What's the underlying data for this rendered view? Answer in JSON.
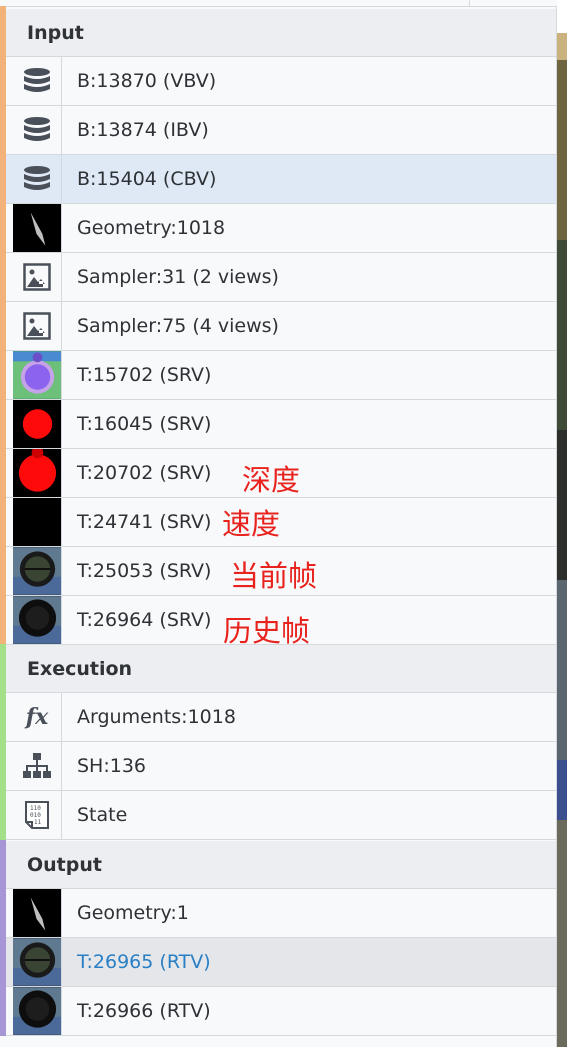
{
  "colors": {
    "input_accent": "#f2b27a",
    "execution_accent": "#a4e08a",
    "output_accent": "#a796d6",
    "link": "#2a7fc4",
    "annotation": "#e8231e",
    "selected_row": "#dfe9f6"
  },
  "sections": {
    "input": {
      "title": "Input",
      "rows": [
        {
          "label": "B:13870 (VBV)",
          "icon": "database-icon"
        },
        {
          "label": "B:13874 (IBV)",
          "icon": "database-icon"
        },
        {
          "label": "B:15404 (CBV)",
          "icon": "database-icon",
          "selected": true
        },
        {
          "label": "Geometry:1018",
          "icon": "geometry-thumbnail"
        },
        {
          "label": "Sampler:31 (2 views)",
          "icon": "sampler-image-icon"
        },
        {
          "label": "Sampler:75 (4 views)",
          "icon": "sampler-image-icon"
        },
        {
          "label": "T:15702 (SRV)",
          "icon": "texture-thumbnail-purple-circle"
        },
        {
          "label": "T:16045 (SRV)",
          "icon": "texture-thumbnail-red-circle"
        },
        {
          "label": "T:20702 (SRV)",
          "icon": "texture-thumbnail-red-circle"
        },
        {
          "label": "T:24741 (SRV)",
          "icon": "texture-thumbnail-black"
        },
        {
          "label": "T:25053 (SRV)",
          "icon": "texture-thumbnail-scope"
        },
        {
          "label": "T:26964 (SRV)",
          "icon": "texture-thumbnail-scope"
        }
      ]
    },
    "execution": {
      "title": "Execution",
      "rows": [
        {
          "label": "Arguments:1018",
          "icon": "function-icon"
        },
        {
          "label": "SH:136",
          "icon": "hierarchy-icon"
        },
        {
          "label": "State",
          "icon": "binary-file-icon"
        }
      ]
    },
    "output": {
      "title": "Output",
      "rows": [
        {
          "label": "Geometry:1",
          "icon": "geometry-thumbnail"
        },
        {
          "label": "T:26965 (RTV)",
          "icon": "texture-thumbnail-scope",
          "hovered": true
        },
        {
          "label": "T:26966 (RTV)",
          "icon": "texture-thumbnail-scope"
        }
      ]
    }
  },
  "annotations": {
    "depth": "深度",
    "velocity": "速度",
    "current_frame": "当前帧",
    "history_frame": "历史帧"
  }
}
